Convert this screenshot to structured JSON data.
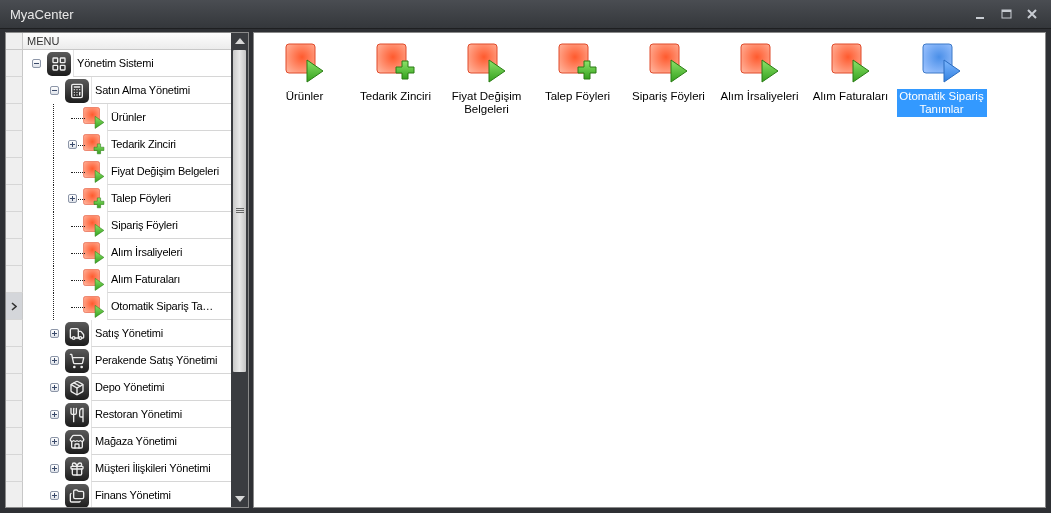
{
  "window": {
    "title": "MyaCenter"
  },
  "menu": {
    "header": "MENU",
    "tree": [
      {
        "label": "Yönetim Sistemi",
        "kind": "module",
        "expanded": true,
        "focused": false,
        "children": [
          {
            "label": "Satın Alma Yönetimi",
            "kind": "module",
            "expanded": true,
            "focused": false,
            "children": [
              {
                "label": "Ürünler",
                "kind": "play",
                "focused": false
              },
              {
                "label": "Tedarik Zinciri",
                "kind": "plus",
                "expanded": false,
                "focused": false
              },
              {
                "label": "Fiyat Değişim Belgeleri",
                "kind": "play",
                "focused": false
              },
              {
                "label": "Talep Föyleri",
                "kind": "plus",
                "expanded": false,
                "focused": false
              },
              {
                "label": "Sipariş Föyleri",
                "kind": "play",
                "focused": false
              },
              {
                "label": "Alım İrsaliyeleri",
                "kind": "play",
                "focused": false
              },
              {
                "label": "Alım Faturaları",
                "kind": "play",
                "focused": false
              },
              {
                "label": "Otomatik Sipariş Ta…",
                "kind": "play",
                "focused": true
              }
            ]
          },
          {
            "label": "Satış Yönetimi",
            "kind": "module",
            "expanded": false,
            "focused": false
          },
          {
            "label": "Perakende Satış Yönetimi",
            "kind": "module",
            "expanded": false,
            "focused": false
          },
          {
            "label": "Depo Yönetimi",
            "kind": "module",
            "expanded": false,
            "focused": false
          },
          {
            "label": "Restoran Yönetimi",
            "kind": "module",
            "expanded": false,
            "focused": false
          },
          {
            "label": "Mağaza Yönetimi",
            "kind": "module",
            "expanded": false,
            "focused": false
          },
          {
            "label": "Müşteri İlişkileri Yönetimi",
            "kind": "module",
            "expanded": false,
            "focused": false
          },
          {
            "label": "Finans Yönetimi",
            "kind": "module",
            "expanded": false,
            "focused": false
          }
        ]
      }
    ]
  },
  "items": [
    {
      "label": "Ürünler",
      "kind": "play",
      "selected": false
    },
    {
      "label": "Tedarik Zinciri",
      "kind": "plus",
      "selected": false
    },
    {
      "label": "Fiyat Değişim Belgeleri",
      "kind": "play",
      "selected": false
    },
    {
      "label": "Talep Föyleri",
      "kind": "plus",
      "selected": false
    },
    {
      "label": "Sipariş Föyleri",
      "kind": "play",
      "selected": false
    },
    {
      "label": "Alım İrsaliyeleri",
      "kind": "play",
      "selected": false
    },
    {
      "label": "Alım Faturaları",
      "kind": "play",
      "selected": false
    },
    {
      "label": "Otomatik Sipariş Tanımlar",
      "kind": "play",
      "selected": true
    }
  ]
}
